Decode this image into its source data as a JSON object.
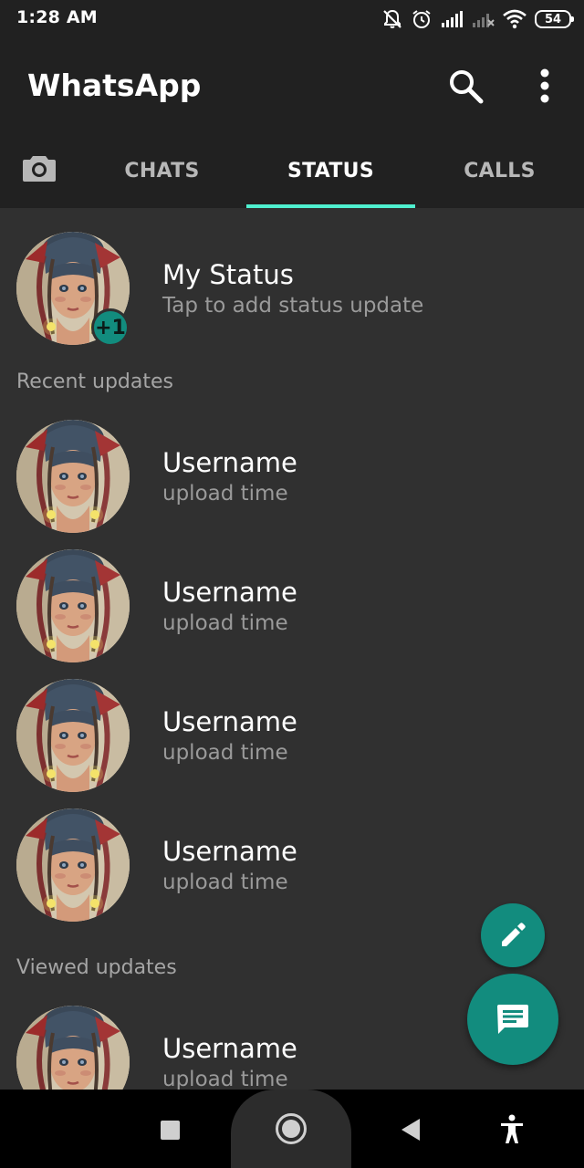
{
  "status_bar": {
    "time": "1:28 AM",
    "battery": "54",
    "icons": [
      "mute-icon",
      "alarm-icon",
      "signal-icon",
      "no-signal-icon",
      "wifi-icon",
      "battery-icon"
    ]
  },
  "app_bar": {
    "title": "WhatsApp",
    "icons": [
      "search-icon",
      "more-vert-icon"
    ]
  },
  "tabs": {
    "camera_icon": "camera-icon",
    "items": [
      {
        "label": "CHATS",
        "active": false
      },
      {
        "label": "STATUS",
        "active": true
      },
      {
        "label": "CALLS",
        "active": false
      }
    ],
    "indicator_color": "#4ff0cf"
  },
  "my_status": {
    "name": "My Status",
    "subtitle": "Tap to add status update",
    "badge": "+1"
  },
  "recent_updates": {
    "label": "Recent updates",
    "items": [
      {
        "name": "Username",
        "time": "upload time"
      },
      {
        "name": "Username",
        "time": "upload time"
      },
      {
        "name": "Username",
        "time": "upload time"
      },
      {
        "name": "Username",
        "time": "upload time"
      }
    ]
  },
  "viewed_updates": {
    "label": "Viewed updates",
    "items": [
      {
        "name": "Username",
        "time": "upload time"
      }
    ]
  },
  "fabs": {
    "edit_icon": "pencil-icon",
    "new_status_icon": "message-icon",
    "color": "#128c7e"
  },
  "colors": {
    "background": "#303030",
    "app_bar": "#212121",
    "accent": "#128c7e"
  }
}
